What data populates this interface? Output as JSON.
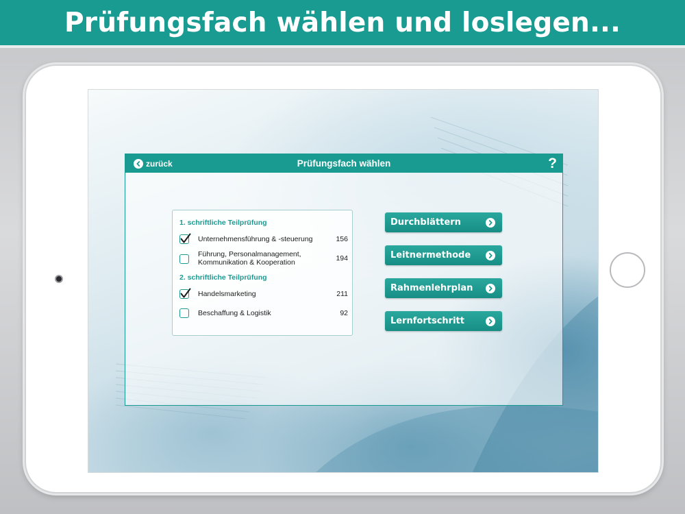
{
  "banner": {
    "title": "Prüfungsfach wählen und loslegen..."
  },
  "header": {
    "back_label": "zurück",
    "title": "Prüfungsfach wählen",
    "help_label": "?"
  },
  "sections": [
    {
      "heading": "1. schriftliche Teilprüfung",
      "subjects": [
        {
          "label": "Unternehmensführung & -steuerung",
          "count": "156",
          "checked": true
        },
        {
          "label_line1": "Führung, Personalmanagement,",
          "label_line2": "Kommunikation & Kooperation",
          "count": "194",
          "checked": false
        }
      ]
    },
    {
      "heading": "2. schriftliche Teilprüfung",
      "subjects": [
        {
          "label": "Handelsmarketing",
          "count": "211",
          "checked": true
        },
        {
          "label": "Beschaffung & Logistik",
          "count": "92",
          "checked": false
        }
      ]
    }
  ],
  "actions": [
    {
      "label": "Durchblättern"
    },
    {
      "label": "Leitnermethode"
    },
    {
      "label": "Rahmenlehrplan"
    },
    {
      "label": "Lernfortschritt"
    }
  ],
  "colors": {
    "accent": "#1a9b91",
    "banner": "#1a9b91",
    "text": "#1b1b1b"
  },
  "icons": {
    "back": "chevron-left-icon",
    "action": "chevron-right-icon",
    "check": "checkmark-icon"
  }
}
